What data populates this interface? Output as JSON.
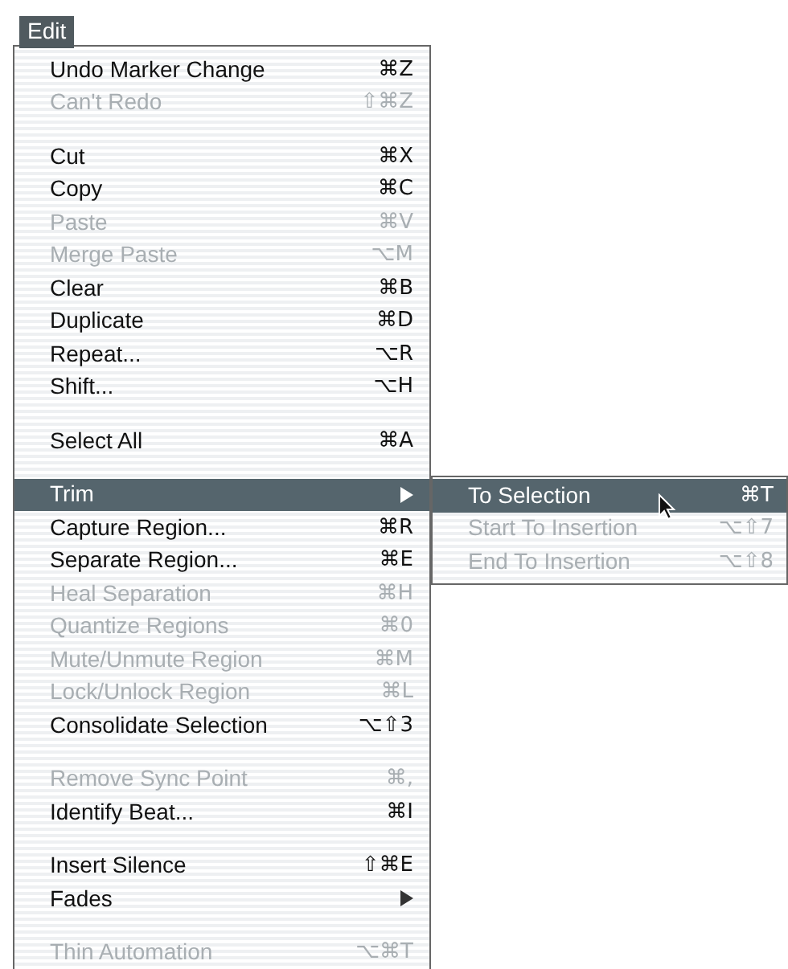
{
  "menu_bar": {
    "title": "Edit",
    "selected": true
  },
  "menu": [
    {
      "kind": "item",
      "label": "Undo Marker Change",
      "shortcut": "⌘Z",
      "disabled": false,
      "selected": false,
      "submenu": false
    },
    {
      "kind": "item",
      "label": "Can't Redo",
      "shortcut": "⇧⌘Z",
      "disabled": true,
      "selected": false,
      "submenu": false
    },
    {
      "kind": "separator"
    },
    {
      "kind": "item",
      "label": "Cut",
      "shortcut": "⌘X",
      "disabled": false,
      "selected": false,
      "submenu": false
    },
    {
      "kind": "item",
      "label": "Copy",
      "shortcut": "⌘C",
      "disabled": false,
      "selected": false,
      "submenu": false
    },
    {
      "kind": "item",
      "label": "Paste",
      "shortcut": "⌘V",
      "disabled": true,
      "selected": false,
      "submenu": false
    },
    {
      "kind": "item",
      "label": "Merge Paste",
      "shortcut": "⌥M",
      "disabled": true,
      "selected": false,
      "submenu": false
    },
    {
      "kind": "item",
      "label": "Clear",
      "shortcut": "⌘B",
      "disabled": false,
      "selected": false,
      "submenu": false
    },
    {
      "kind": "item",
      "label": "Duplicate",
      "shortcut": "⌘D",
      "disabled": false,
      "selected": false,
      "submenu": false
    },
    {
      "kind": "item",
      "label": "Repeat...",
      "shortcut": "⌥R",
      "disabled": false,
      "selected": false,
      "submenu": false
    },
    {
      "kind": "item",
      "label": "Shift...",
      "shortcut": "⌥H",
      "disabled": false,
      "selected": false,
      "submenu": false
    },
    {
      "kind": "separator"
    },
    {
      "kind": "item",
      "label": "Select All",
      "shortcut": "⌘A",
      "disabled": false,
      "selected": false,
      "submenu": false
    },
    {
      "kind": "separator"
    },
    {
      "kind": "item",
      "label": "Trim",
      "disabled": false,
      "selected": true,
      "submenu": true
    },
    {
      "kind": "item",
      "label": "Capture Region...",
      "shortcut": "⌘R",
      "disabled": false,
      "selected": false,
      "submenu": false
    },
    {
      "kind": "item",
      "label": "Separate Region...",
      "shortcut": "⌘E",
      "disabled": false,
      "selected": false,
      "submenu": false
    },
    {
      "kind": "item",
      "label": "Heal Separation",
      "shortcut": "⌘H",
      "disabled": true,
      "selected": false,
      "submenu": false
    },
    {
      "kind": "item",
      "label": "Quantize Regions",
      "shortcut": "⌘0",
      "disabled": true,
      "selected": false,
      "submenu": false
    },
    {
      "kind": "item",
      "label": "Mute/Unmute Region",
      "shortcut": "⌘M",
      "disabled": true,
      "selected": false,
      "submenu": false
    },
    {
      "kind": "item",
      "label": "Lock/Unlock Region",
      "shortcut": "⌘L",
      "disabled": true,
      "selected": false,
      "submenu": false
    },
    {
      "kind": "item",
      "label": "Consolidate Selection",
      "shortcut": "⌥⇧3",
      "disabled": false,
      "selected": false,
      "submenu": false
    },
    {
      "kind": "separator"
    },
    {
      "kind": "item",
      "label": "Remove Sync Point",
      "shortcut": "⌘,",
      "disabled": true,
      "selected": false,
      "submenu": false
    },
    {
      "kind": "item",
      "label": "Identify Beat...",
      "shortcut": "⌘I",
      "disabled": false,
      "selected": false,
      "submenu": false
    },
    {
      "kind": "separator"
    },
    {
      "kind": "item",
      "label": "Insert Silence",
      "shortcut": "⇧⌘E",
      "disabled": false,
      "selected": false,
      "submenu": false
    },
    {
      "kind": "item",
      "label": "Fades",
      "disabled": false,
      "selected": false,
      "submenu": true
    },
    {
      "kind": "separator"
    },
    {
      "kind": "item",
      "label": "Thin Automation",
      "shortcut": "⌥⌘T",
      "disabled": true,
      "selected": false,
      "submenu": false
    }
  ],
  "submenu": [
    {
      "label": "To Selection",
      "shortcut": "⌘T",
      "disabled": false,
      "selected": true
    },
    {
      "label": "Start To Insertion",
      "shortcut": "⌥⇧7",
      "disabled": true,
      "selected": false
    },
    {
      "label": "End To Insertion",
      "shortcut": "⌥⇧8",
      "disabled": true,
      "selected": false
    }
  ]
}
